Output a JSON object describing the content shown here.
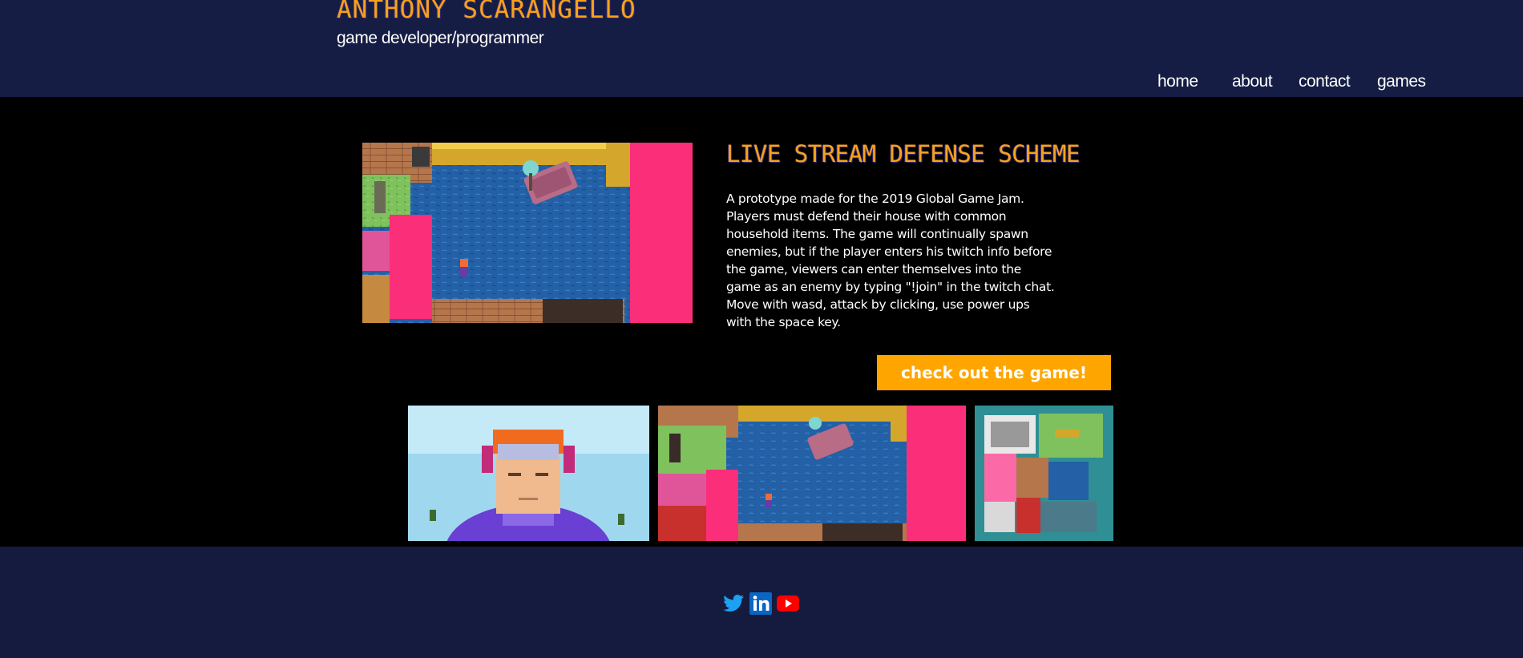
{
  "header": {
    "title": "ANTHONY SCARANGELLO",
    "subtitle": "game developer/programmer",
    "nav": [
      "home",
      "about",
      "contact",
      "games"
    ]
  },
  "game": {
    "title": "LIVE STREAM DEFENSE SCHEME",
    "description": "A prototype made for the 2019 Global Game Jam. Players must defend their house with common household items. The game will continually spawn enemies, but if the player enters his twitch info before the game, viewers can enter themselves into the game as an enemy by typing \"!join\" in the twitch chat. Move with wasd, attack by clicking, use power ups with the space key.",
    "cta_label": "check out the game!"
  },
  "footer": {
    "social_icons": [
      "twitter-icon",
      "linkedin-icon",
      "youtube-icon"
    ]
  },
  "colors": {
    "accent": "#f7a21c",
    "button": "#ffa500",
    "header_bg": "#151d44",
    "main_bg": "#000000"
  }
}
